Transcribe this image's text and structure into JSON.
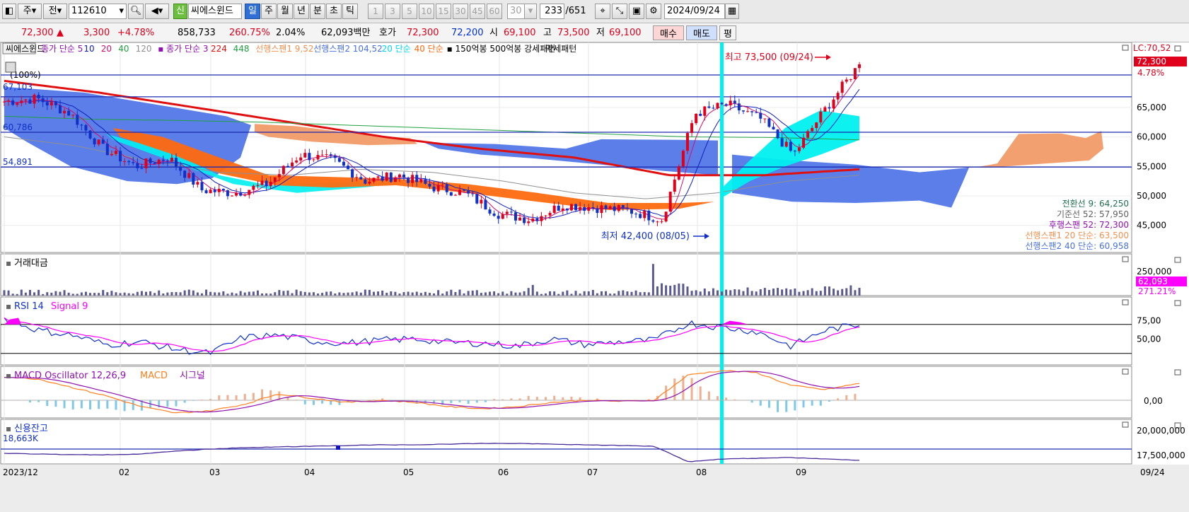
{
  "toolbar": {
    "period_label": "주",
    "prev_label": "전",
    "code": "112610",
    "credit_badge": "신",
    "stock_name": "씨에스윈드",
    "tabs": [
      "일",
      "주",
      "월",
      "년",
      "분",
      "초",
      "틱"
    ],
    "active_tab": "일",
    "intervals": [
      "1",
      "3",
      "5",
      "10",
      "15",
      "30",
      "45",
      "60"
    ],
    "interval_value": "30",
    "count": "233",
    "total_label": "/651",
    "date": "2024/09/24"
  },
  "quote": {
    "price": "72,300",
    "change": "3,300",
    "change_pct": "+4.78%",
    "volume": "858,733",
    "vol_ratio": "260.75%",
    "turnover": "2.04%",
    "amount": "62,093백만",
    "hoga_label": "호가",
    "ask": "72,300",
    "bid": "72,200",
    "open_label": "시",
    "open": "69,100",
    "high_label": "고",
    "high": "73,500",
    "low_label": "저",
    "low": "69,100",
    "buy_label": "매수",
    "sell_label": "매도",
    "eval_label": "평"
  },
  "colors": {
    "up": "#e0001b",
    "down": "#1030c8",
    "cloud_blue": "#5b7ee8",
    "cloud_orange": "#f2a070",
    "orange_fill": "#ff6a10",
    "cyan": "#00f0f0",
    "ma_red": "#e01010",
    "hline": "#1c2bb0",
    "magenta": "#ff00ff"
  },
  "main_legend": [
    {
      "text": "씨에스윈드",
      "color": "#000000",
      "box": true
    },
    {
      "text": "종가 단순 5",
      "color": "#9010b0"
    },
    {
      "text": "10",
      "color": "#1020c0"
    },
    {
      "text": "20",
      "color": "#d01070"
    },
    {
      "text": "40",
      "color": "#20a040"
    },
    {
      "text": "120",
      "color": "#909090"
    },
    {
      "text": "▪ 종가 단순 3",
      "color": "#9010b0"
    },
    {
      "text": "224",
      "color": "#e01010"
    },
    {
      "text": "448",
      "color": "#20a040"
    },
    {
      "text": "선행스팬1 9,52",
      "color": "#f29050"
    },
    {
      "text": "선행스팬2 104,52",
      "color": "#4a70e0"
    },
    {
      "text": "20 단순",
      "color": "#00d8e8"
    },
    {
      "text": "40 단순",
      "color": "#ff6a10"
    },
    {
      "text": "▪ 150억봉 500억봉 강세패턴",
      "color": "#000000"
    },
    {
      "text": "약세패턴",
      "color": "#000000"
    }
  ],
  "price_axis": {
    "ticks": [
      "65,000",
      "60,000",
      "55,000",
      "50,000",
      "45,000"
    ],
    "lc_label": "LC:70,52",
    "last_price": "72,300",
    "last_pct": "4.78%"
  },
  "levels": [
    {
      "label": "",
      "value": 70.5
    },
    {
      "label": "",
      "value": 66.8
    },
    {
      "label": "60,786",
      "value": 60.786
    },
    {
      "label": "54,891",
      "value": 54.891
    }
  ],
  "left_labels": {
    "top": "67,103",
    "pct": "(100%)"
  },
  "annotations": {
    "high": "최고 73,500 (09/24)",
    "low": "최저 42,400 (08/05)"
  },
  "ichimoku_values": [
    {
      "text": "전환선 9: 64,250",
      "color": "#207050"
    },
    {
      "text": "기준선 52: 57,950",
      "color": "#606060"
    },
    {
      "text": "후행스팬 52: 72,300",
      "color": "#9010b0"
    },
    {
      "text": "선행스팬1 20 단순: 63,500",
      "color": "#f29050"
    },
    {
      "text": "선행스팬2 40 단순: 60,958",
      "color": "#4a70e0"
    }
  ],
  "volume_panel": {
    "title": "거래대금",
    "axis_tick": "250,000",
    "last_value": "62,093",
    "last_pct": "271.21%"
  },
  "rsi_panel": {
    "title": "RSI 14",
    "signal": "Signal 9",
    "ticks": [
      "75,00",
      "50,00"
    ]
  },
  "macd_panel": {
    "title": "MACD Oscillator 12,26,9",
    "macd": "MACD",
    "signal": "시그널",
    "tick": "0,00"
  },
  "credit_panel": {
    "title": "신용잔고",
    "value": "18,663K",
    "ticks": [
      "20,000,000",
      "17,500,000"
    ]
  },
  "x_axis": {
    "labels": [
      "2023/12",
      "02",
      "03",
      "04",
      "05",
      "06",
      "07",
      "08",
      "09"
    ],
    "right_label": "09/24"
  },
  "chart_data": {
    "type": "line",
    "title": "씨에스윈드",
    "x": [
      "2023/12",
      "02",
      "03",
      "04",
      "05",
      "06",
      "07",
      "08",
      "09",
      "09/24"
    ],
    "series": [
      {
        "name": "종가 단순 5",
        "values": [
          66000,
          58000,
          51000,
          57000,
          53500,
          51500,
          47000,
          48000,
          64000,
          72300
        ]
      },
      {
        "name": "224",
        "values": [
          69500,
          67500,
          65000,
          62500,
          60000,
          58000,
          56500,
          53500,
          53500,
          54500
        ]
      }
    ],
    "ylabel": "",
    "ylim": [
      41000,
      73500
    ],
    "high": {
      "value": 73500,
      "date": "09/24"
    },
    "low": {
      "value": 42400,
      "date": "08/05"
    }
  }
}
